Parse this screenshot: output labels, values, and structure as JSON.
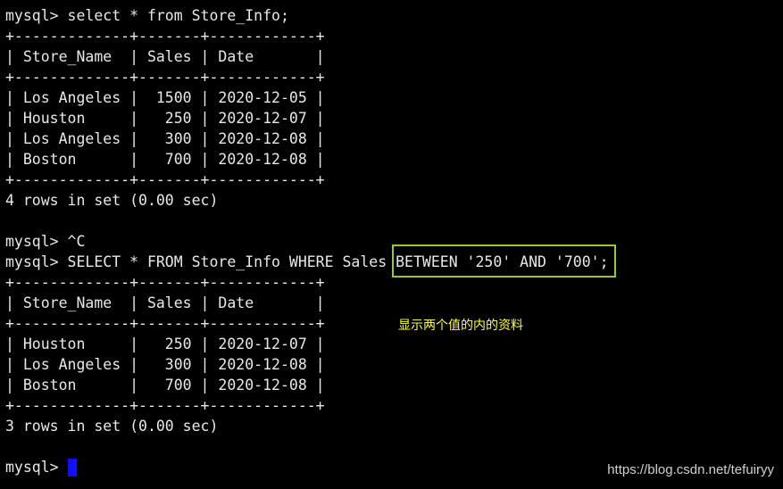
{
  "terminal": {
    "lines": [
      "mysql> select * from Store_Info;",
      "+-------------+-------+------------+",
      "| Store_Name  | Sales | Date       |",
      "+-------------+-------+------------+",
      "| Los Angeles |  1500 | 2020-12-05 |",
      "| Houston     |   250 | 2020-12-07 |",
      "| Los Angeles |   300 | 2020-12-08 |",
      "| Boston      |   700 | 2020-12-08 |",
      "+-------------+-------+------------+",
      "4 rows in set (0.00 sec)",
      "",
      "mysql> ^C",
      "mysql> SELECT * FROM Store_Info WHERE Sales BETWEEN '250' AND '700';",
      "+-------------+-------+------------+",
      "| Store_Name  | Sales | Date       |",
      "+-------------+-------+------------+",
      "| Houston     |   250 | 2020-12-07 |",
      "| Los Angeles |   300 | 2020-12-08 |",
      "| Boston      |   700 | 2020-12-08 |",
      "+-------------+-------+------------+",
      "3 rows in set (0.00 sec)",
      "",
      "mysql> "
    ]
  },
  "annotation": "显示两个值的内的资料",
  "watermark": "https://blog.csdn.net/tefuiryy",
  "colors": {
    "background": "#000000",
    "text": "#e8e8e8",
    "highlight_box": "#9bc53d",
    "annotation": "#ffff33",
    "cursor": "#1010ff"
  }
}
